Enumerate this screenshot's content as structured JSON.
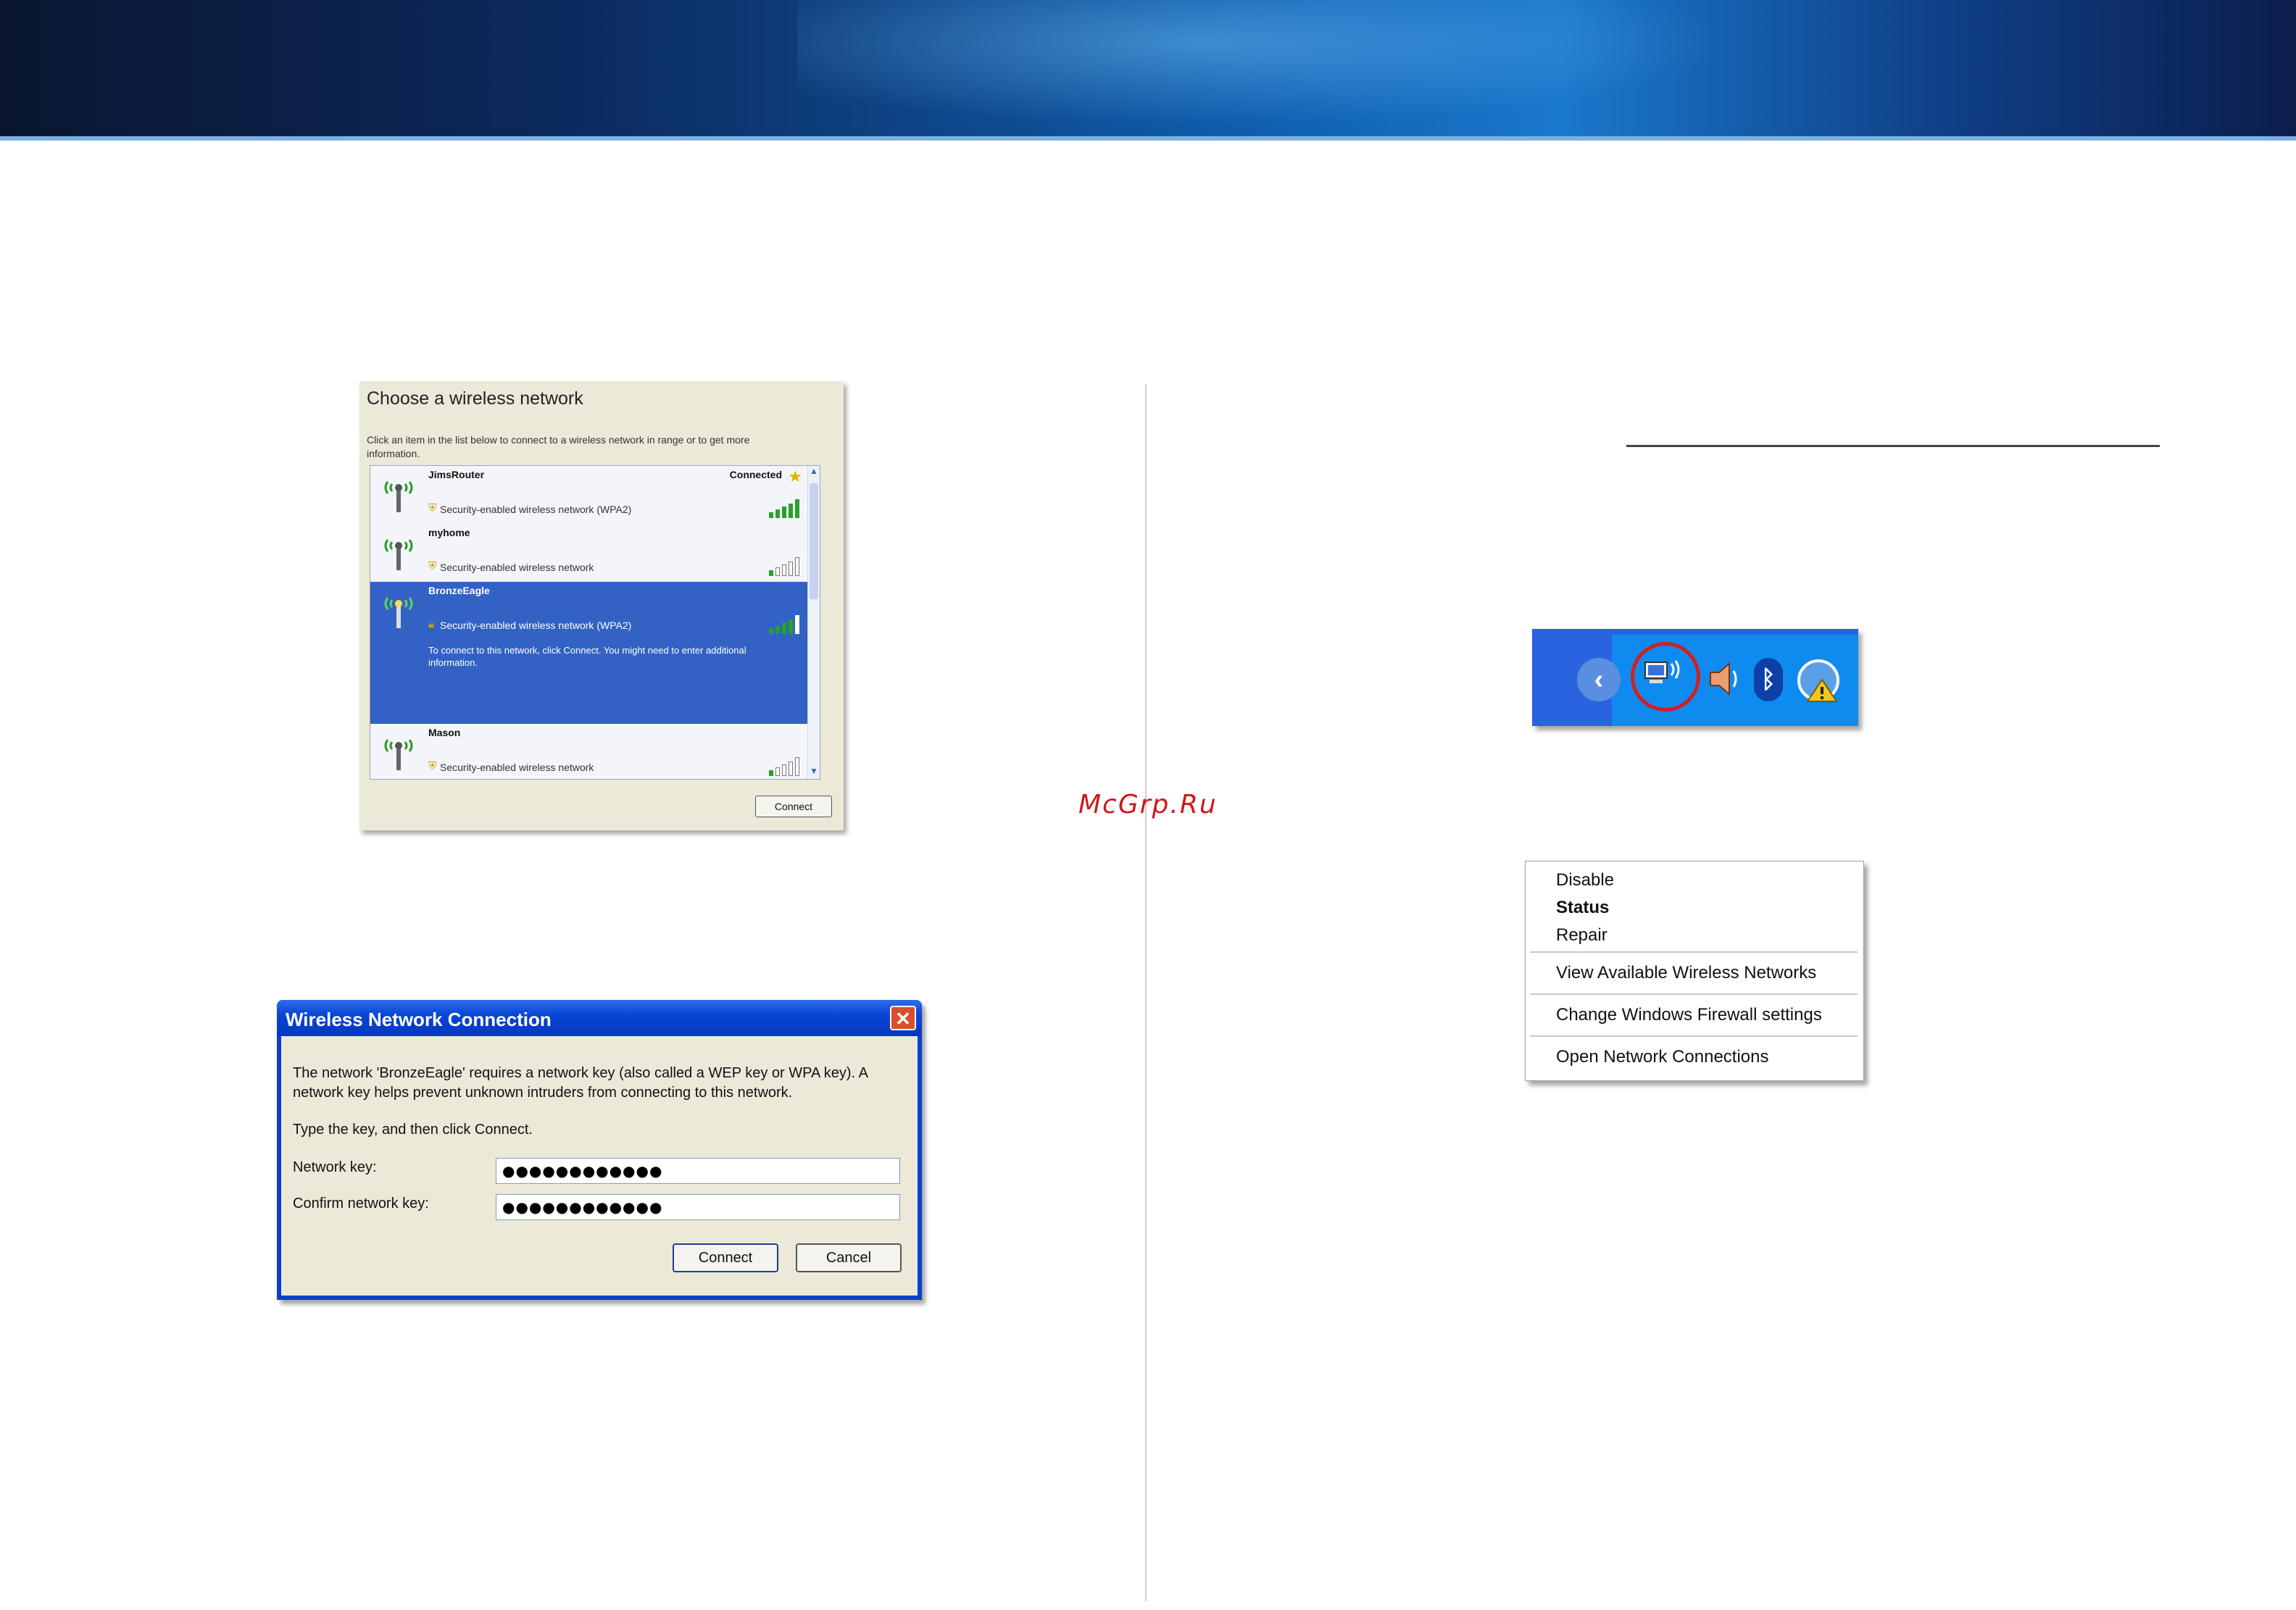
{
  "watermark": "McGrp.Ru",
  "choose_network": {
    "title": "Choose a wireless network",
    "description": "Click an item in the list below to connect to a wireless network in range or to get more information.",
    "networks": [
      {
        "name": "JimsRouter",
        "status": "Connected",
        "security": "Security-enabled wireless network (WPA2)",
        "signal": 5
      },
      {
        "name": "myhome",
        "status": "",
        "security": "Security-enabled wireless network",
        "signal": 1
      },
      {
        "name": "BronzeEagle",
        "status": "",
        "security": "Security-enabled wireless network (WPA2)",
        "signal": 4,
        "selected": true,
        "hint": "To connect to this network, click Connect. You might need to enter additional information."
      },
      {
        "name": "Mason",
        "status": "",
        "security": "Security-enabled wireless network",
        "signal": 1
      }
    ],
    "connect_label": "Connect"
  },
  "wnc_dialog": {
    "title": "Wireless Network Connection",
    "message": "The network 'BronzeEagle' requires a network key (also called a WEP key or WPA key). A network key helps prevent unknown intruders from connecting to this network.",
    "instruction": "Type the key, and then click Connect.",
    "network_key_label": "Network key:",
    "network_key_value": "●●●●●●●●●●●●",
    "confirm_key_label": "Confirm network key:",
    "confirm_key_value": "●●●●●●●●●●●●",
    "connect_label": "Connect",
    "cancel_label": "Cancel"
  },
  "tray": {
    "icons": [
      "chevron-left-icon",
      "wireless-network-icon",
      "speaker-icon",
      "bluetooth-icon",
      "security-alert-icon"
    ],
    "highlight_color": "#d11f1f"
  },
  "context_menu": {
    "items": [
      "Disable",
      "Status",
      "Repair",
      "View Available Wireless Networks",
      "Change Windows Firewall settings",
      "Open Network Connections"
    ]
  }
}
